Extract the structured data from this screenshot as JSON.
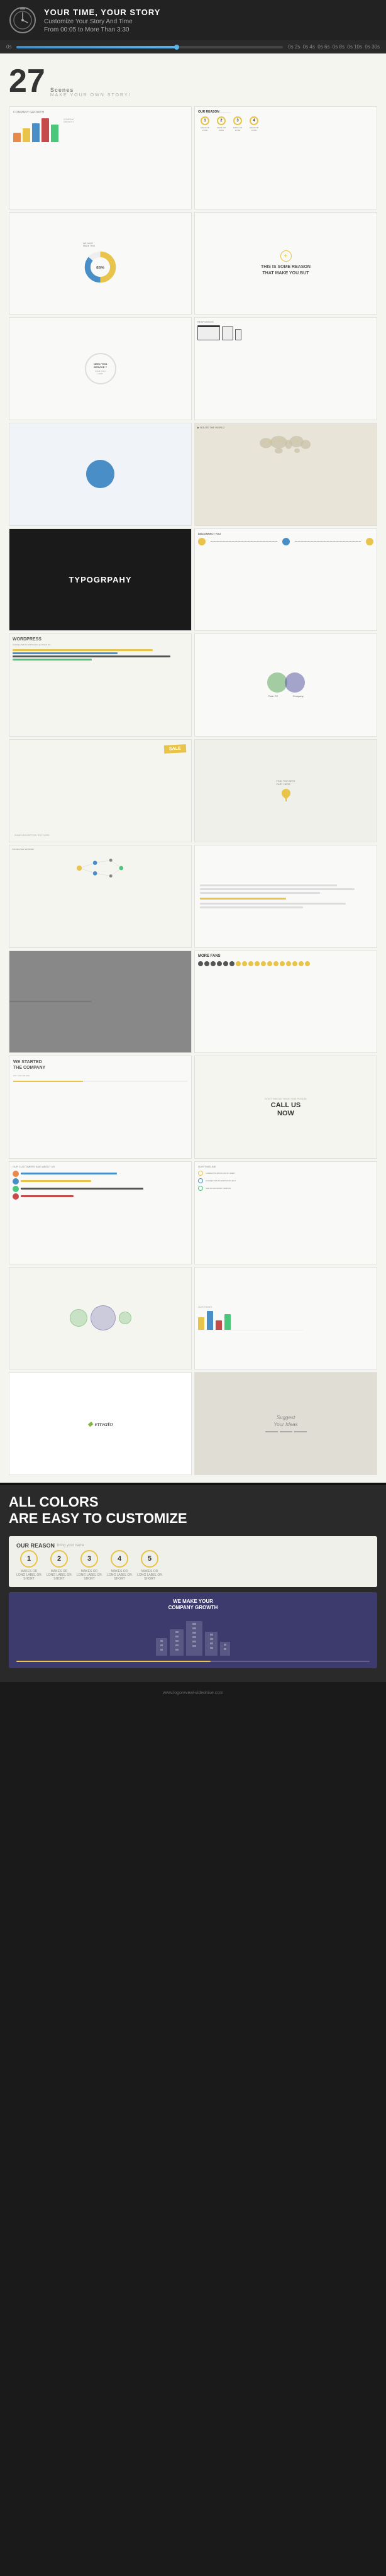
{
  "header": {
    "title": "YOUR TIME, YOUR STORY",
    "subtitle1": "Customize Your Story And Time",
    "subtitle2": "From 00:05 to More Than 3:30",
    "timeline": {
      "start": "0s",
      "marks": [
        "0s 2s",
        "0s 4s",
        "0s 6s",
        "0s 8s",
        "0s 10s",
        "0s 12s"
      ],
      "end": "0s 30s"
    }
  },
  "scenes": {
    "count": "27",
    "label": "MAKE YOUR OWN STORY!"
  },
  "scene_list": [
    {
      "id": "s1",
      "type": "bar-chart",
      "title": "COMPANY GROWTH"
    },
    {
      "id": "s2",
      "type": "our-reason",
      "title": "OUR REASON"
    },
    {
      "id": "s3",
      "type": "donut",
      "title": ""
    },
    {
      "id": "s4",
      "type": "reason-text",
      "title": "THIS IS SOME REASON THAT MAKE YOU BUT"
    },
    {
      "id": "s5",
      "type": "need-service",
      "title": "NEED THIS SERVICE ?"
    },
    {
      "id": "s6",
      "type": "responsive",
      "title": "RESPONSIVE"
    },
    {
      "id": "s7",
      "type": "blue-circle",
      "title": ""
    },
    {
      "id": "s8",
      "type": "world-map",
      "title": "ROUTE THE WORLD"
    },
    {
      "id": "s9",
      "type": "typography",
      "title": "TYPOGRPAHY"
    },
    {
      "id": "s10",
      "type": "disconnect",
      "title": "DISCONNECT YOU"
    },
    {
      "id": "s11",
      "type": "wordpress",
      "title": "WORDPRESS"
    },
    {
      "id": "s12",
      "type": "venn",
      "title": "Polar PC    Company"
    },
    {
      "id": "s13",
      "type": "sale",
      "title": "SALE"
    },
    {
      "id": "s14",
      "type": "location",
      "title": ""
    },
    {
      "id": "s15",
      "type": "network",
      "title": ""
    },
    {
      "id": "s16",
      "type": "text-line",
      "title": ""
    },
    {
      "id": "s17",
      "type": "photo",
      "title": ""
    },
    {
      "id": "s18",
      "type": "more-fans",
      "title": "MORE FANS"
    },
    {
      "id": "s19",
      "type": "started",
      "title": "WE STARTED THE COMPANY"
    },
    {
      "id": "s20",
      "type": "call-us",
      "title": "CALL US NOW"
    },
    {
      "id": "s21",
      "type": "customers",
      "title": "OUR CUSTOMERS SAID ABOUT US"
    },
    {
      "id": "s22",
      "type": "timeline-items",
      "title": ""
    },
    {
      "id": "s23",
      "type": "bubbles",
      "title": ""
    },
    {
      "id": "s24",
      "type": "mixed",
      "title": ""
    },
    {
      "id": "s25",
      "type": "envato",
      "title": "envato"
    },
    {
      "id": "s26",
      "type": "suggest",
      "title": "Suggest Your Ideas"
    }
  ],
  "colors_section": {
    "title_line1": "ALL COLORS",
    "title_line2": "ARE EASY TO CUSTOMIZE"
  },
  "demo_reason": {
    "title": "OUR REASON",
    "subtitle": "bring your name",
    "steps": [
      {
        "num": "1",
        "label": "MAKES OR LONG LABEL OR SHORT"
      },
      {
        "num": "2",
        "label": "MAKES OR LONG LABEL OR SHORT"
      },
      {
        "num": "3",
        "label": "MAKES OR LONG LABEL OR SHORT"
      },
      {
        "num": "4",
        "label": "MAKES OR LONG LABEL OR SHORT"
      },
      {
        "num": "5",
        "label": "MAKES OR LONG LABEL OR SHORT"
      }
    ]
  },
  "demo_growth": {
    "title_line1": "WE MAKE YOUR",
    "title_line2": "COMPANY GROWTH"
  },
  "footer": {
    "url": "www.logoreveal-videohive.com"
  }
}
